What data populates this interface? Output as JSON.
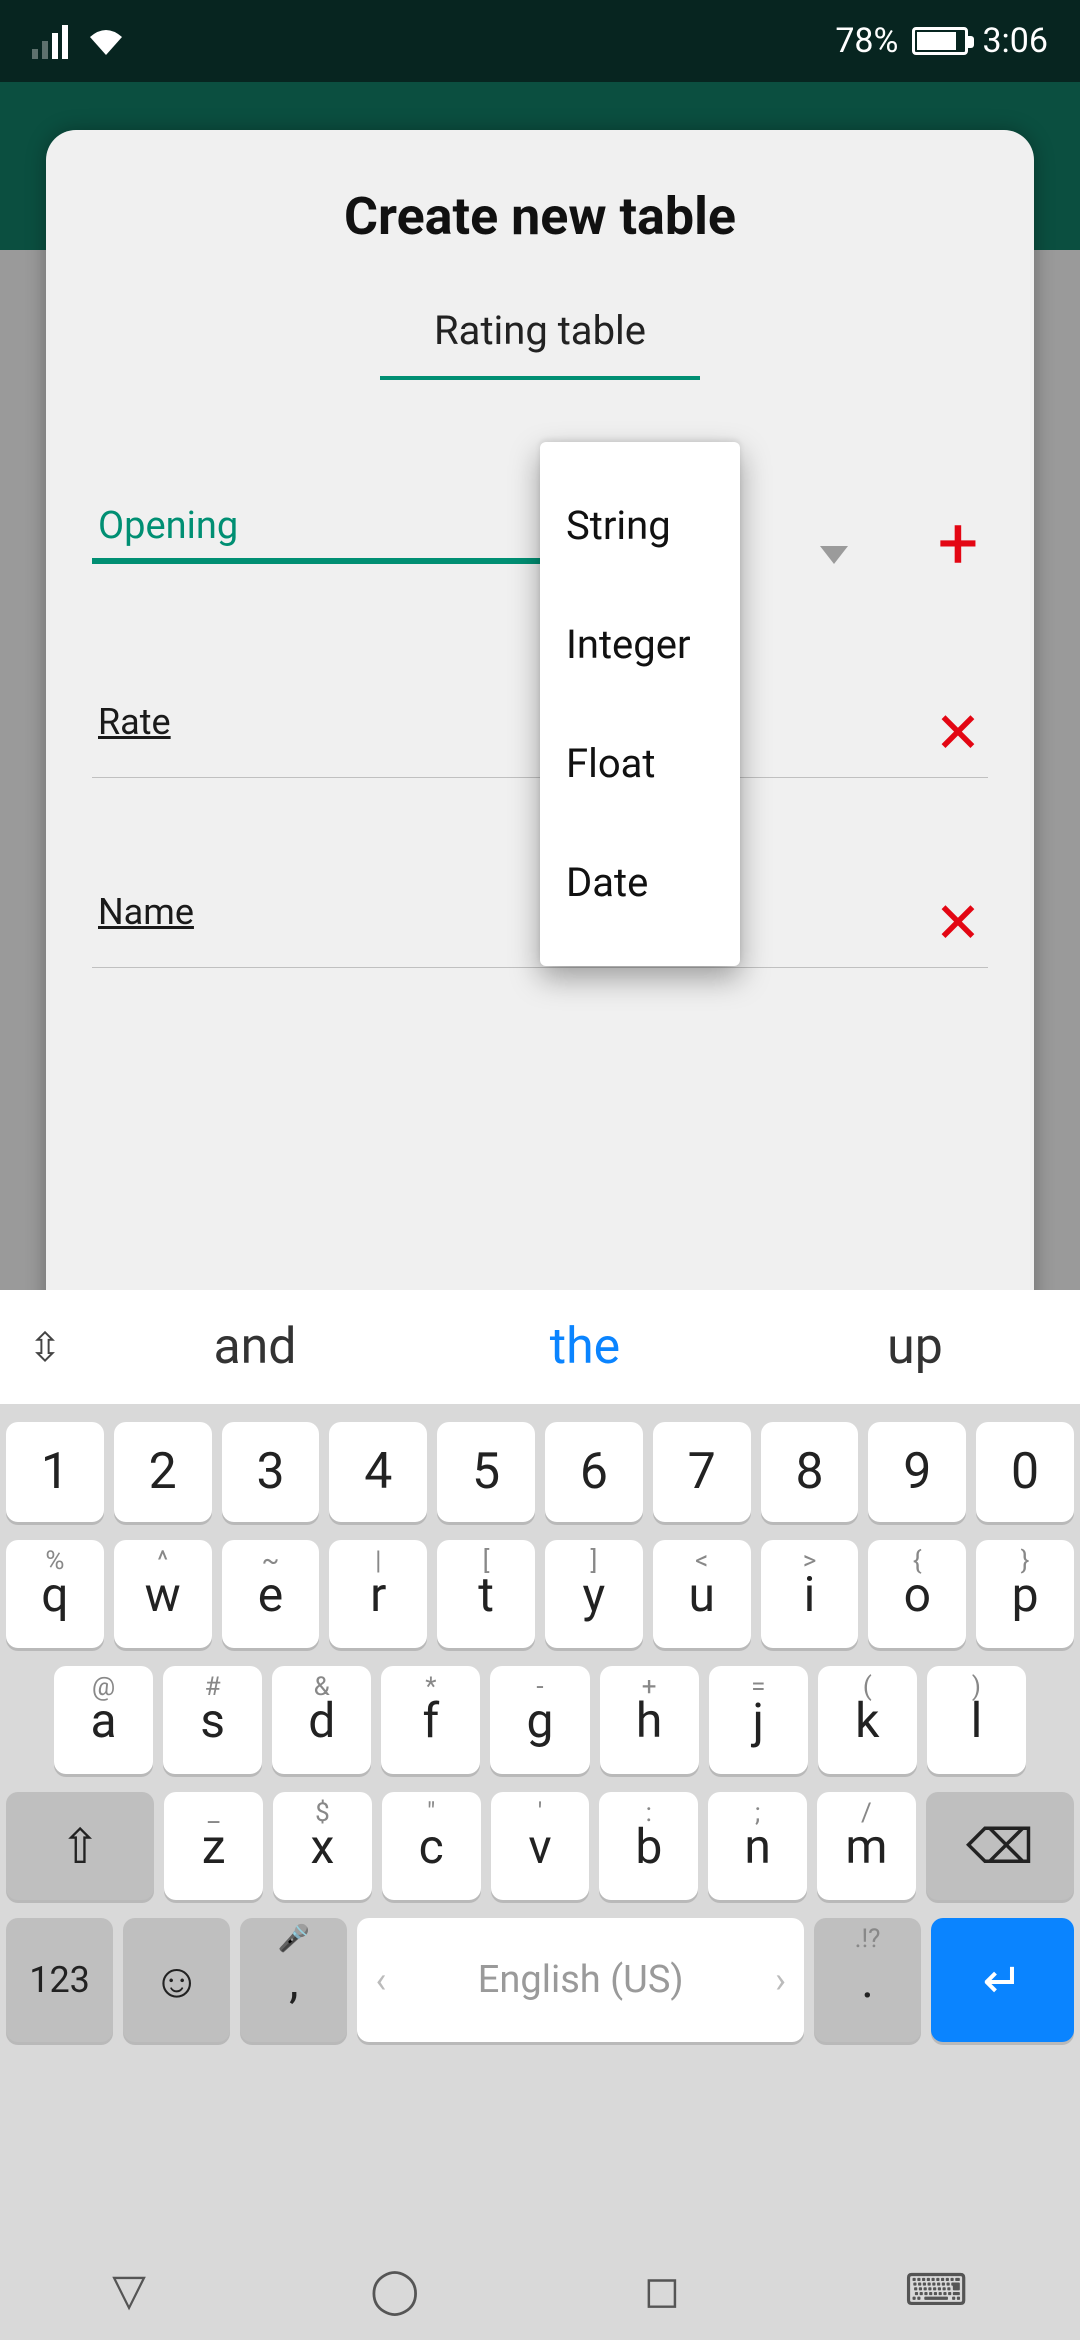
{
  "statusbar": {
    "battery_pct": "78%",
    "time": "3:06"
  },
  "modal": {
    "title": "Create new table",
    "table_name_value": "Rating table",
    "rows": [
      {
        "field_value": "Opening",
        "type_selected": "String",
        "action": "add"
      },
      {
        "field_value": "Rate",
        "action": "remove"
      },
      {
        "field_value": "Name",
        "action": "remove"
      }
    ]
  },
  "dropdown": {
    "options": [
      "String",
      "Integer",
      "Float",
      "Date"
    ]
  },
  "keyboard": {
    "suggestions": [
      "and",
      "the",
      "up"
    ],
    "language_label": "English (US)",
    "row_num": [
      "1",
      "2",
      "3",
      "4",
      "5",
      "6",
      "7",
      "8",
      "9",
      "0"
    ],
    "row1_alt": [
      "%",
      "^",
      "~",
      "|",
      "[",
      "]",
      "<",
      ">",
      "{",
      "}"
    ],
    "row1": [
      "q",
      "w",
      "e",
      "r",
      "t",
      "y",
      "u",
      "i",
      "o",
      "p"
    ],
    "row2_alt": [
      "@",
      "#",
      "&",
      "*",
      "-",
      "+",
      "=",
      "(",
      ")"
    ],
    "row2": [
      "a",
      "s",
      "d",
      "f",
      "g",
      "h",
      "j",
      "k",
      "l"
    ],
    "row3_alt": [
      "_",
      "$",
      "\"",
      "'",
      ":",
      ";",
      "/"
    ],
    "row3": [
      "z",
      "x",
      "c",
      "v",
      "b",
      "n",
      "m"
    ],
    "key_123": "123",
    "key_comma": ",",
    "key_period_alt": ".!?",
    "key_period": "."
  }
}
